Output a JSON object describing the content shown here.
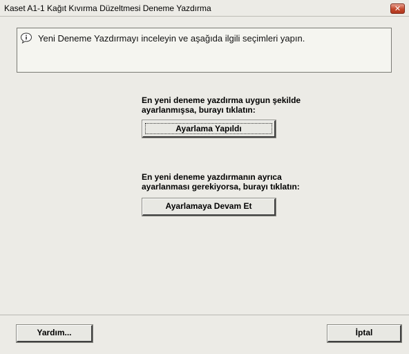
{
  "window": {
    "title": "Kaset A1-1 Kağıt Kıvırma Düzeltmesi Deneme Yazdırma",
    "close_symbol": "✕"
  },
  "info": {
    "icon": "speech-info-icon",
    "text": "Yeni Deneme Yazdırmayı inceleyin ve aşağıda ilgili seçimleri yapın."
  },
  "section1": {
    "prompt_line1": "En yeni deneme yazdırma uygun şekilde",
    "prompt_line2": "ayarlanmışsa, burayı tıklatın:",
    "button_label": "Ayarlama Yapıldı"
  },
  "section2": {
    "prompt_line1": "En yeni deneme yazdırmanın ayrıca",
    "prompt_line2": "ayarlanması gerekiyorsa, burayı tıklatın:",
    "button_label": "Ayarlamaya Devam Et"
  },
  "footer": {
    "help_label": "Yardım...",
    "cancel_label": "İptal"
  },
  "colors": {
    "window_bg": "#ecebe6",
    "close_button": "#c4472b"
  }
}
